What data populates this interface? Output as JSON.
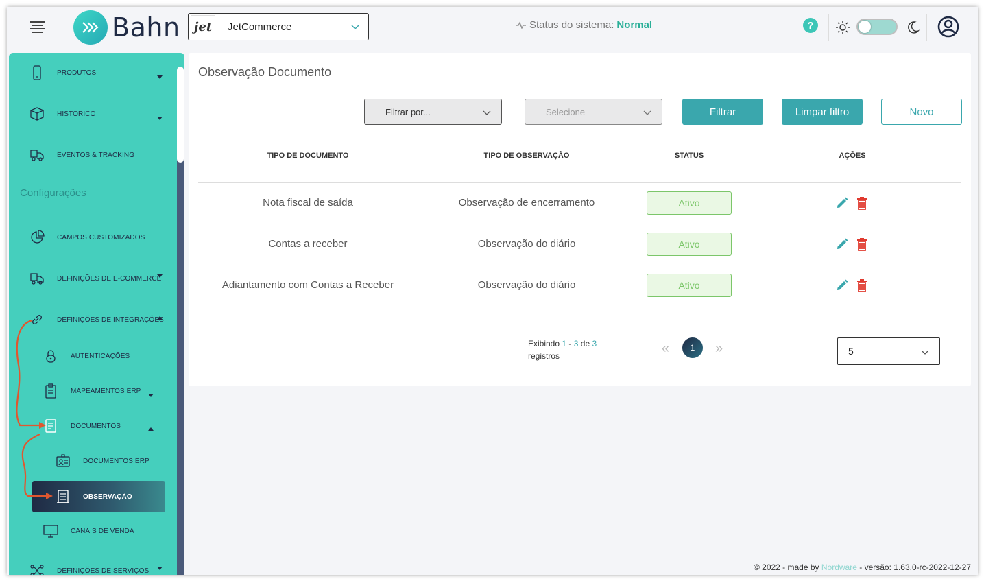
{
  "header": {
    "logo_text": "Bahn",
    "company": {
      "logo_text": "jet",
      "name": "JetCommerce"
    },
    "status_label": "Status do sistema:",
    "status_value": "Normal",
    "help_symbol": "?"
  },
  "sidebar": {
    "items_top": [
      {
        "label": "PRODUTOS",
        "icon": "phone-icon"
      },
      {
        "label": "HISTÓRICO",
        "icon": "box-icon"
      },
      {
        "label": "EVENTOS & TRACKING",
        "icon": "truck-icon"
      }
    ],
    "section_title": "Configurações",
    "items_config": [
      {
        "label": "CAMPOS CUSTOMIZADOS",
        "icon": "pie-chart-icon"
      },
      {
        "label": "DEFINIÇÕES DE E-COMMERCE",
        "icon": "truck-icon"
      },
      {
        "label": "DEFINIÇÕES DE INTEGRAÇÕES",
        "icon": "link-icon"
      },
      {
        "label": "AUTENTICAÇÕES",
        "icon": "lock-icon"
      },
      {
        "label": "MAPEAMENTOS ERP",
        "icon": "clipboard-icon"
      },
      {
        "label": "DOCUMENTOS",
        "icon": "document-icon"
      },
      {
        "label": "DOCUMENTOS ERP",
        "icon": "id-card-icon"
      },
      {
        "label": "OBSERVAÇÃO",
        "icon": "note-icon"
      },
      {
        "label": "CANAIS DE VENDA",
        "icon": "monitor-icon"
      },
      {
        "label": "DEFINIÇÕES DE SERVIÇOS",
        "icon": "services-icon"
      }
    ]
  },
  "main": {
    "title": "Observação Documento",
    "filter_by_placeholder": "Filtrar por...",
    "select_placeholder": "Selecione",
    "btn_filter": "Filtrar",
    "btn_clear": "Limpar filtro",
    "btn_new": "Novo",
    "table": {
      "headers": [
        "TIPO DE DOCUMENTO",
        "TIPO DE OBSERVAÇÃO",
        "STATUS",
        "AÇÕES"
      ],
      "rows": [
        {
          "doc": "Nota fiscal de saída",
          "obs": "Observação de encerramento",
          "status": "Ativo"
        },
        {
          "doc": "Contas a receber",
          "obs": "Observação do diário",
          "status": "Ativo"
        },
        {
          "doc": "Adiantamento com Contas a Receber",
          "obs": "Observação do diário",
          "status": "Ativo"
        }
      ]
    },
    "pagination": {
      "showing": "Exibindo",
      "from": "1",
      "dash": "-",
      "to": "3",
      "of": "de",
      "total": "3",
      "records": "registros",
      "current_page": "1",
      "prev": "«",
      "next": "»",
      "page_size": "5"
    }
  },
  "footer": {
    "prefix": "© 2022 - made by",
    "brand": "Nordware",
    "version": "- versão: 1.63.0-rc-2022-12-27"
  },
  "colors": {
    "accent": "#3aa7ad",
    "sidebar": "#45cfbd",
    "dark": "#1f2a44",
    "success": "#7cc66a",
    "danger": "#e03a2f",
    "arrow": "#e0572f"
  }
}
